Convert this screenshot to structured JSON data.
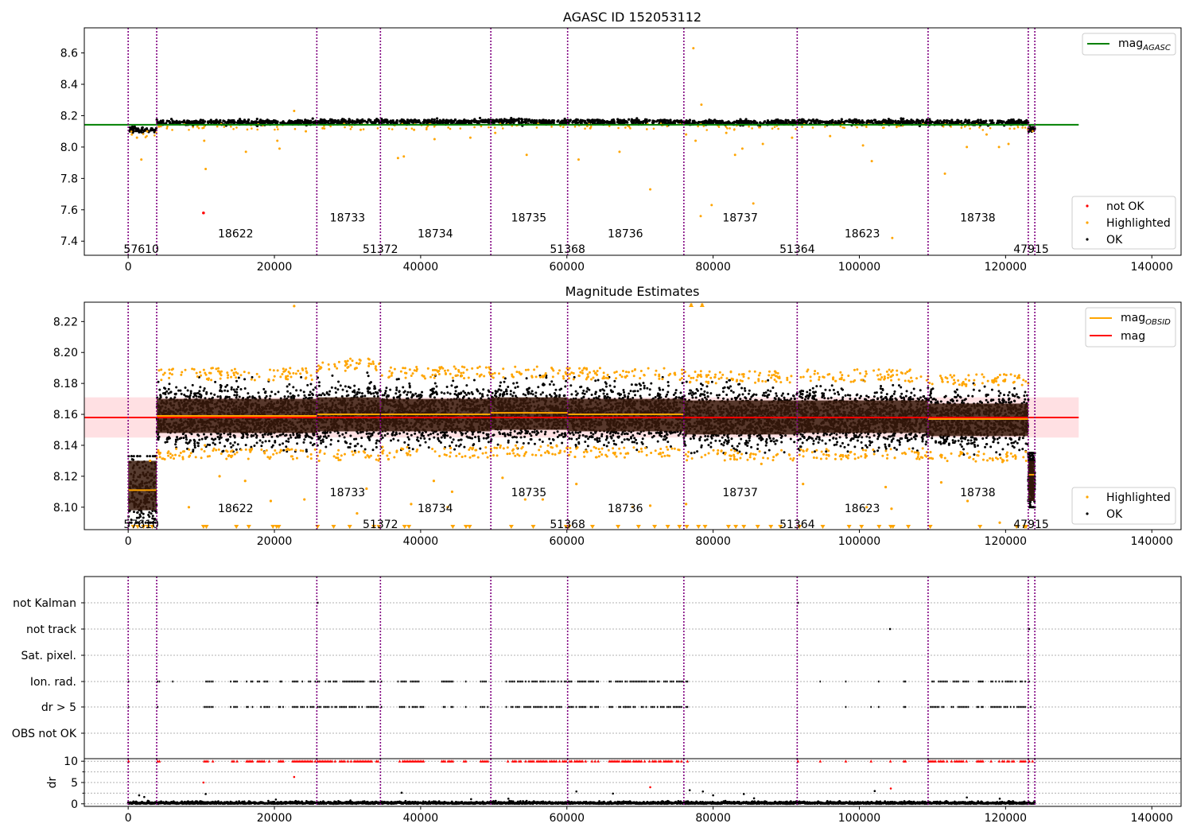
{
  "figure": {
    "x_ticks": [
      0,
      20000,
      40000,
      60000,
      80000,
      100000,
      120000,
      140000
    ],
    "xlim": [
      -6000,
      144000
    ],
    "obs_boundaries": [
      0,
      3900,
      25800,
      34500,
      49600,
      60100,
      76000,
      91500,
      109400,
      123100,
      124000
    ]
  },
  "chart_data": [
    {
      "type": "scatter",
      "title": "AGASC ID 152053112",
      "ylim": [
        7.31,
        8.76
      ],
      "y_ticks": [
        7.4,
        7.6,
        7.8,
        8.0,
        8.2,
        8.4,
        8.6
      ],
      "xlabel": "",
      "ylabel": "",
      "grid": false,
      "lines": [
        {
          "name": "mag_AGASC",
          "label_main": "mag",
          "label_sub": "AGASC",
          "color": "#008000",
          "y": 8.142,
          "x": [
            -6000,
            130000
          ]
        }
      ],
      "series": [
        {
          "name": "not OK",
          "color": "#ff0000"
        },
        {
          "name": "Highlighted",
          "color": "#ffa500"
        },
        {
          "name": "OK",
          "color": "#000000"
        }
      ],
      "legend": {
        "upper": "upper right",
        "lower": "lower right"
      },
      "highlighted_points": [
        [
          500,
          8.08
        ],
        [
          1200,
          8.06
        ],
        [
          1800,
          7.92
        ],
        [
          2600,
          8.1
        ],
        [
          4200,
          8.13
        ],
        [
          10400,
          8.04
        ],
        [
          10600,
          7.86
        ],
        [
          16100,
          7.97
        ],
        [
          20400,
          8.04
        ],
        [
          20700,
          7.99
        ],
        [
          22700,
          8.23
        ],
        [
          24300,
          8.1
        ],
        [
          26600,
          8.12
        ],
        [
          31800,
          8.11
        ],
        [
          36900,
          7.93
        ],
        [
          37700,
          7.94
        ],
        [
          39100,
          8.11
        ],
        [
          41900,
          8.05
        ],
        [
          46800,
          8.06
        ],
        [
          50200,
          8.09
        ],
        [
          54500,
          7.95
        ],
        [
          61600,
          7.92
        ],
        [
          63200,
          8.12
        ],
        [
          67200,
          7.97
        ],
        [
          71400,
          7.73
        ],
        [
          76300,
          8.08
        ],
        [
          77300,
          8.63
        ],
        [
          77600,
          8.04
        ],
        [
          78300,
          7.56
        ],
        [
          78400,
          8.27
        ],
        [
          79800,
          7.63
        ],
        [
          81800,
          8.09
        ],
        [
          83000,
          7.95
        ],
        [
          84000,
          7.99
        ],
        [
          85500,
          7.64
        ],
        [
          86800,
          8.02
        ],
        [
          90800,
          8.06
        ],
        [
          96000,
          8.07
        ],
        [
          100500,
          8.01
        ],
        [
          101700,
          7.91
        ],
        [
          104500,
          7.42
        ],
        [
          111700,
          7.83
        ],
        [
          114700,
          8.0
        ],
        [
          117400,
          8.08
        ],
        [
          119100,
          8.0
        ],
        [
          120400,
          8.02
        ]
      ],
      "not_ok_points": [
        [
          10300,
          7.58
        ]
      ],
      "ok_bands": [
        {
          "x0": 0,
          "x1": 3900,
          "y": 8.11
        },
        {
          "x0": 3900,
          "x1": 25800,
          "y": 8.158
        },
        {
          "x0": 25800,
          "x1": 34500,
          "y": 8.162
        },
        {
          "x0": 34500,
          "x1": 49600,
          "y": 8.161
        },
        {
          "x0": 49600,
          "x1": 60100,
          "y": 8.162
        },
        {
          "x0": 60100,
          "x1": 76000,
          "y": 8.161
        },
        {
          "x0": 76000,
          "x1": 91500,
          "y": 8.157
        },
        {
          "x0": 91500,
          "x1": 109400,
          "y": 8.159
        },
        {
          "x0": 109400,
          "x1": 123100,
          "y": 8.157
        },
        {
          "x0": 123100,
          "x1": 124000,
          "y": 8.115
        }
      ],
      "annotations": [
        {
          "text": "57610",
          "x": 1800,
          "y": 7.35
        },
        {
          "text": "18622",
          "x": 14700,
          "y": 7.45
        },
        {
          "text": "18733",
          "x": 30000,
          "y": 7.55
        },
        {
          "text": "51372",
          "x": 34500,
          "y": 7.35
        },
        {
          "text": "18734",
          "x": 42000,
          "y": 7.45
        },
        {
          "text": "18735",
          "x": 54800,
          "y": 7.55
        },
        {
          "text": "51368",
          "x": 60100,
          "y": 7.35
        },
        {
          "text": "18736",
          "x": 68000,
          "y": 7.45
        },
        {
          "text": "18737",
          "x": 83700,
          "y": 7.55
        },
        {
          "text": "51364",
          "x": 91500,
          "y": 7.35
        },
        {
          "text": "18623",
          "x": 100400,
          "y": 7.45
        },
        {
          "text": "18738",
          "x": 116200,
          "y": 7.55
        },
        {
          "text": "47915",
          "x": 123500,
          "y": 7.35
        }
      ]
    },
    {
      "type": "scatter",
      "title": "Magnitude Estimates",
      "ylim": [
        8.0855,
        8.2325
      ],
      "y_ticks": [
        8.1,
        8.12,
        8.14,
        8.16,
        8.18,
        8.2,
        8.22
      ],
      "xlabel": "",
      "ylabel": "",
      "grid": false,
      "mag": {
        "name": "mag",
        "value": 8.158,
        "band": [
          8.145,
          8.171
        ],
        "x": [
          -6000,
          130000
        ],
        "color": "#ff0000"
      },
      "mag_obsid": {
        "name": "mag_OBSID",
        "label_main": "mag",
        "label_sub": "OBSID",
        "color": "#ffa500"
      },
      "series": [
        {
          "name": "Highlighted",
          "color": "#ffa500"
        },
        {
          "name": "OK",
          "color": "#000000"
        }
      ],
      "legend": {
        "upper": "upper right",
        "lower": "lower right"
      },
      "obs_segments": [
        {
          "x0": 0,
          "x1": 3900,
          "mean": 8.111,
          "lo": 8.098,
          "hi": 8.13,
          "outer_lo": 8.09,
          "outer_hi": 8.133
        },
        {
          "x0": 3900,
          "x1": 25800,
          "mean": 8.159,
          "lo": 8.148,
          "hi": 8.17,
          "outer_lo": 8.136,
          "outer_hi": 8.184
        },
        {
          "x0": 25800,
          "x1": 34500,
          "mean": 8.16,
          "lo": 8.149,
          "hi": 8.171,
          "outer_lo": 8.135,
          "outer_hi": 8.19
        },
        {
          "x0": 34500,
          "x1": 49600,
          "mean": 8.16,
          "lo": 8.149,
          "hi": 8.17,
          "outer_lo": 8.137,
          "outer_hi": 8.185
        },
        {
          "x0": 49600,
          "x1": 60100,
          "mean": 8.161,
          "lo": 8.15,
          "hi": 8.171,
          "outer_lo": 8.138,
          "outer_hi": 8.185
        },
        {
          "x0": 60100,
          "x1": 76000,
          "mean": 8.16,
          "lo": 8.149,
          "hi": 8.17,
          "outer_lo": 8.137,
          "outer_hi": 8.184
        },
        {
          "x0": 76000,
          "x1": 91500,
          "mean": 8.158,
          "lo": 8.147,
          "hi": 8.169,
          "outer_lo": 8.135,
          "outer_hi": 8.182
        },
        {
          "x0": 91500,
          "x1": 109400,
          "mean": 8.158,
          "lo": 8.148,
          "hi": 8.169,
          "outer_lo": 8.136,
          "outer_hi": 8.183
        },
        {
          "x0": 109400,
          "x1": 123100,
          "mean": 8.157,
          "lo": 8.146,
          "hi": 8.167,
          "outer_lo": 8.134,
          "outer_hi": 8.18
        },
        {
          "x0": 123100,
          "x1": 124000,
          "mean": 8.121,
          "lo": 8.104,
          "hi": 8.13,
          "outer_lo": 8.1,
          "outer_hi": 8.135
        }
      ],
      "highlighted_points": [
        [
          3000,
          8.13
        ],
        [
          8300,
          8.1
        ],
        [
          10500,
          8.14
        ],
        [
          12500,
          8.12
        ],
        [
          16000,
          8.117
        ],
        [
          19500,
          8.104
        ],
        [
          24100,
          8.105
        ],
        [
          26100,
          8.13
        ],
        [
          31300,
          8.096
        ],
        [
          32600,
          8.112
        ],
        [
          35600,
          8.131
        ],
        [
          38700,
          8.102
        ],
        [
          41800,
          8.117
        ],
        [
          43700,
          8.1
        ],
        [
          44300,
          8.11
        ],
        [
          51200,
          8.119
        ],
        [
          54300,
          8.105
        ],
        [
          56700,
          8.105
        ],
        [
          61300,
          8.115
        ],
        [
          69000,
          8.1
        ],
        [
          71400,
          8.101
        ],
        [
          76300,
          8.102
        ],
        [
          83400,
          8.135
        ],
        [
          86600,
          8.128
        ],
        [
          92300,
          8.115
        ],
        [
          101000,
          8.1
        ],
        [
          103600,
          8.113
        ],
        [
          104400,
          8.099
        ],
        [
          111200,
          8.116
        ],
        [
          114800,
          8.104
        ],
        [
          119200,
          8.09
        ],
        [
          22700,
          8.23
        ],
        [
          77000,
          8.231
        ],
        [
          78500,
          8.231
        ]
      ],
      "clipped_low_x": [
        700,
        1300,
        2100,
        2700,
        3300,
        10300,
        10700,
        14800,
        16500,
        19800,
        20300,
        20600,
        25900,
        28100,
        30300,
        33600,
        34300,
        37800,
        38400,
        44400,
        46200,
        46700,
        52400,
        55400,
        59900,
        60300,
        63500,
        67000,
        69800,
        72000,
        73800,
        75400,
        76400,
        78000,
        78900,
        82100,
        83100,
        84200,
        86100,
        87900,
        89200,
        91800,
        95000,
        98600,
        100300,
        102700,
        104300,
        104600,
        106700,
        109700,
        116500,
        121500,
        122600,
        122800
      ]
    },
    {
      "type": "scatter",
      "title": "",
      "xlabel": "",
      "ylabel": "",
      "grid": true,
      "flag_rows": [
        "not Kalman",
        "not track",
        "Sat. pixel.",
        "Ion. rad.",
        "dr > 5",
        "OBS not OK"
      ],
      "flag_events": {
        "not Kalman": [
          25900,
          91600
        ],
        "not track": [
          104200,
          123200
        ],
        "Sat. pixel.": [],
        "Ion. rad.": [
          [
            0,
            100
          ],
          [
            3900,
            4400
          ],
          [
            6000,
            6200
          ],
          [
            10300,
            11700
          ],
          [
            13900,
            15000
          ],
          [
            16100,
            17100
          ],
          [
            17600,
            19400
          ],
          [
            20500,
            21300
          ],
          [
            22400,
            25700
          ],
          [
            25800,
            34500
          ],
          [
            34500,
            34800
          ],
          [
            36800,
            40500
          ],
          [
            42800,
            44500
          ],
          [
            45800,
            46300
          ],
          [
            48100,
            49300
          ],
          [
            51600,
            60000
          ],
          [
            60100,
            64400
          ],
          [
            65700,
            68100
          ],
          [
            67900,
            76000
          ],
          [
            76200,
            76600
          ],
          [
            91500,
            91700
          ],
          [
            94500,
            94800
          ],
          [
            98000,
            98300
          ],
          [
            101500,
            101700
          ],
          [
            102500,
            102800
          ],
          [
            104100,
            104400
          ],
          [
            106000,
            106400
          ],
          [
            109400,
            112100
          ],
          [
            112500,
            115000
          ],
          [
            116000,
            117000
          ],
          [
            117900,
            122800
          ],
          [
            123100,
            123800
          ]
        ],
        "dr > 5": [
          [
            0,
            100
          ],
          [
            3900,
            4400
          ],
          [
            6000,
            6200
          ],
          [
            10300,
            11700
          ],
          [
            13900,
            15000
          ],
          [
            16100,
            17100
          ],
          [
            17600,
            19400
          ],
          [
            20500,
            21300
          ],
          [
            22400,
            25700
          ],
          [
            25800,
            34500
          ],
          [
            34500,
            34800
          ],
          [
            36800,
            40500
          ],
          [
            42800,
            44500
          ],
          [
            45800,
            46300
          ],
          [
            48100,
            49300
          ],
          [
            51600,
            60000
          ],
          [
            60100,
            64400
          ],
          [
            65700,
            68100
          ],
          [
            67900,
            76000
          ],
          [
            76200,
            76600
          ],
          [
            91500,
            91700
          ],
          [
            94500,
            94800
          ],
          [
            98000,
            98300
          ],
          [
            101500,
            101700
          ],
          [
            102500,
            102800
          ],
          [
            104100,
            104400
          ],
          [
            106000,
            106400
          ],
          [
            109400,
            112100
          ],
          [
            112500,
            115000
          ],
          [
            116000,
            117000
          ],
          [
            117900,
            122800
          ],
          [
            123100,
            123800
          ]
        ],
        "OBS not OK": []
      }
    },
    {
      "type": "scatter",
      "ylabel": "dr",
      "ylim": [
        -0.6,
        10.6
      ],
      "y_ticks": [
        0,
        5,
        10
      ],
      "grid": true,
      "clipped_dr_x": [
        [
          0,
          100
        ],
        [
          3900,
          4400
        ],
        [
          6000,
          6200
        ],
        [
          10300,
          11700
        ],
        [
          13900,
          15000
        ],
        [
          16100,
          17100
        ],
        [
          17600,
          19400
        ],
        [
          20500,
          21300
        ],
        [
          22400,
          25700
        ],
        [
          25800,
          34500
        ],
        [
          34500,
          34800
        ],
        [
          36800,
          40500
        ],
        [
          42800,
          44500
        ],
        [
          45800,
          46300
        ],
        [
          48100,
          49300
        ],
        [
          51600,
          60000
        ],
        [
          60100,
          64400
        ],
        [
          65700,
          68100
        ],
        [
          67900,
          76000
        ],
        [
          76200,
          76600
        ],
        [
          91500,
          91700
        ],
        [
          94500,
          94800
        ],
        [
          98000,
          98300
        ],
        [
          101500,
          101700
        ],
        [
          102500,
          102800
        ],
        [
          104100,
          104400
        ],
        [
          106000,
          106400
        ],
        [
          109400,
          112100
        ],
        [
          112500,
          115000
        ],
        [
          116000,
          117000
        ],
        [
          117900,
          122800
        ],
        [
          123100,
          123800
        ]
      ],
      "red_points": [
        [
          10300,
          5.0
        ],
        [
          22700,
          6.3
        ],
        [
          71400,
          3.9
        ],
        [
          104300,
          3.6
        ]
      ],
      "black_points": [
        [
          1500,
          2.0
        ],
        [
          2200,
          1.6
        ],
        [
          10600,
          2.3
        ],
        [
          20200,
          1.0
        ],
        [
          30400,
          0.8
        ],
        [
          37400,
          2.6
        ],
        [
          46900,
          1.1
        ],
        [
          52000,
          1.2
        ],
        [
          61300,
          2.9
        ],
        [
          66300,
          2.4
        ],
        [
          76800,
          3.2
        ],
        [
          78600,
          2.9
        ],
        [
          80000,
          2.0
        ],
        [
          84200,
          2.3
        ],
        [
          85600,
          1.3
        ],
        [
          102100,
          3.0
        ],
        [
          114700,
          1.5
        ],
        [
          119200,
          1.2
        ]
      ]
    }
  ]
}
